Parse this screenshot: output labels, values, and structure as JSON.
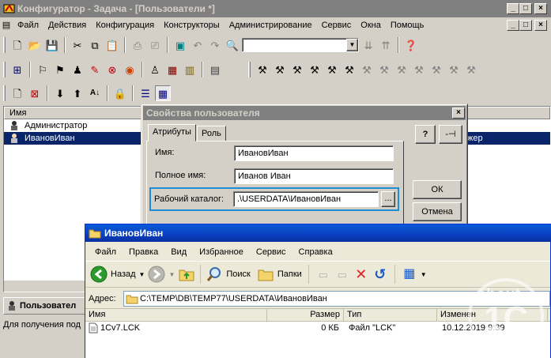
{
  "main_window": {
    "title": "Конфигуратор - Задача - [Пользователи *]",
    "controls": [
      "_",
      "□",
      "×"
    ],
    "child_controls": [
      "_",
      "□",
      "×"
    ]
  },
  "menu": [
    "Файл",
    "Действия",
    "Конфигурация",
    "Конструкторы",
    "Администрирование",
    "Сервис",
    "Окна",
    "Помощь"
  ],
  "list": {
    "column": "Имя",
    "rows": [
      "Администратор",
      "ИвановИван"
    ],
    "right_fragment": "жер"
  },
  "dialog": {
    "title": "Свойства пользователя",
    "close": "×",
    "tabs": [
      "Атрибуты",
      "Роль"
    ],
    "fields": [
      {
        "label": "Имя:",
        "value": "ИвановИван"
      },
      {
        "label": "Полное имя:",
        "value": "Иванов Иван"
      }
    ],
    "workdir": {
      "label": "Рабочий каталог:",
      "value": ".\\USERDATA\\ИвановИван",
      "browse": "..."
    },
    "ok": "ОК",
    "cancel": "Отмена",
    "help": "?",
    "pin": "-⊣"
  },
  "bottom_left": {
    "tab": "Пользовател",
    "status": "Для получения под"
  },
  "explorer": {
    "title": "ИвановИван",
    "menu": [
      "Файл",
      "Правка",
      "Вид",
      "Избранное",
      "Сервис",
      "Справка"
    ],
    "toolbar": {
      "back": "Назад",
      "search": "Поиск",
      "folders": "Папки"
    },
    "address_label": "Адрес:",
    "address": "C:\\TEMP\\DB\\TEMP77\\USERDATA\\ИвановИван",
    "columns": [
      "Имя",
      "Размер",
      "Тип",
      "Изменен"
    ],
    "files": [
      {
        "name": "1Cv7.LCK",
        "size": "0 КБ",
        "type": "Файл \"LCK\"",
        "modified": "10.12.2019 9:39"
      }
    ]
  },
  "watermark": {
    "line1": "about",
    "line2": "1C",
    "line3": ".ru"
  },
  "colors": {
    "title_inactive": "#808080",
    "selection": "#0a246a",
    "highlight": "#1e8fd2",
    "xp_title": "#0a3fc0"
  }
}
